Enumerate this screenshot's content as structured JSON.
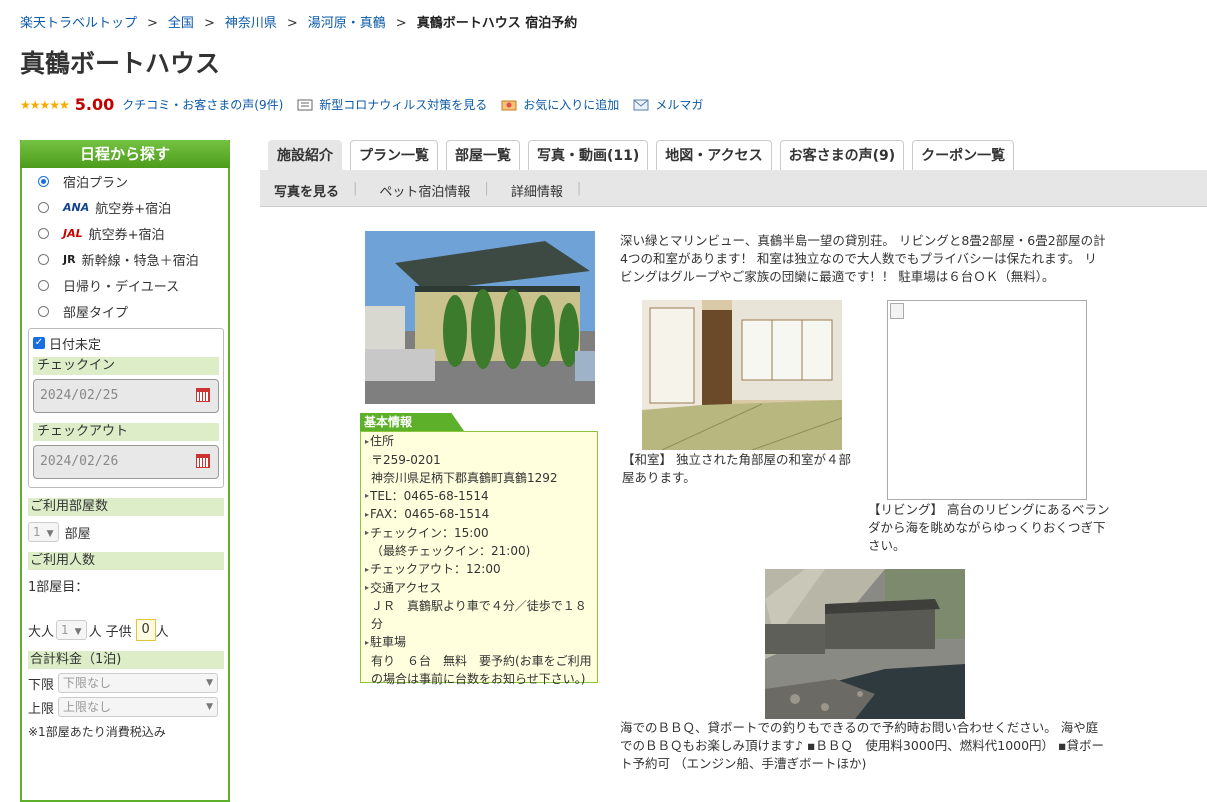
{
  "breadcrumb": {
    "items": [
      "楽天トラベルトップ",
      "全国",
      "神奈川県",
      "湯河原・真鶴"
    ],
    "separator": ">",
    "current": "真鶴ボートハウス 宿泊予約"
  },
  "hotel": {
    "name": "真鶴ボートハウス",
    "stars": "★★★★★",
    "score": "5.00",
    "reviews_link": "クチコミ・お客さまの声(9件)",
    "covid_link": "新型コロナウィルス対策を見る",
    "favorite_link": "お気に入りに追加",
    "mail_link": "メルマガ"
  },
  "sidebar": {
    "title": "日程から探す",
    "options": [
      {
        "prefix": "",
        "label": "宿泊プラン",
        "selected": true
      },
      {
        "prefix": "ANA",
        "label": "航空券+宿泊"
      },
      {
        "prefix": "JAL",
        "label": "航空券+宿泊"
      },
      {
        "prefix": "JR",
        "label": "新幹線・特急＋宿泊"
      },
      {
        "prefix": "",
        "label": "日帰り・デイユース"
      },
      {
        "prefix": "",
        "label": "部屋タイプ"
      }
    ],
    "undecided_label": "日付未定",
    "checkin_label": "チェックイン",
    "checkin_value": "2024/02/25",
    "checkout_label": "チェックアウト",
    "checkout_value": "2024/02/26",
    "rooms_label": "ご利用部屋数",
    "rooms_value": "1",
    "rooms_unit": "部屋",
    "people_label": "ご利用人数",
    "room1_label": "1部屋目：",
    "adult_label": "大人",
    "adult_value": "1",
    "adult_unit": "人",
    "child_label": "子供",
    "child_value": "0",
    "child_unit": "人",
    "total_label": "合計料金（1泊)",
    "min_label": "下限",
    "min_value": "下限なし",
    "max_label": "上限",
    "max_value": "上限なし",
    "note": "※1部屋あたり消費税込み"
  },
  "tabs": [
    "施設紹介",
    "プラン一覧",
    "部屋一覧",
    "写真・動画(11)",
    "地図・アクセス",
    "お客さまの声(9)",
    "クーポン一覧"
  ],
  "subnav": [
    "写真を見る",
    "ペット宿泊情報",
    "詳細情報"
  ],
  "basic_info": {
    "title": "基本情報",
    "address_label": "住所",
    "zip": "〒259-0201",
    "address": "神奈川県足柄下郡真鶴町真鶴1292",
    "tel": "TEL：0465-68-1514",
    "fax": "FAX：0465-68-1514",
    "checkin": "チェックイン：15:00",
    "last_checkin": "（最終チェックイン：21:00)",
    "checkout": "チェックアウト：12:00",
    "access_label": "交通アクセス",
    "access": "ＪＲ　真鶴駅より車で４分／徒歩で１８分",
    "parking_label": "駐車場",
    "parking": "有り　６台　無料　要予約(お車をご利用の場合は事前に台数をお知らせ下さい。)"
  },
  "intro": "深い緑とマリンビュー、真鶴半島一望の貸別荘。 リビングと8畳2部屋・6畳2部屋の計4つの和室があります！ 和室は独立なので大人数でもプライバシーは保たれます。 リビングはグループやご家族の団欒に最適です！！ 駐車場は６台ＯＫ（無料）。",
  "captions": {
    "washitsu": "【和室】 独立された角部屋の和室が４部屋あります。",
    "living": "【リビング】 高台のリビングにあるベランダから海を眺めながらゆっくりおくつぎ下さい。",
    "sea": "海でのＢＢＱ、貸ボートでの釣りもできるので予約時お問い合わせください。 海や庭でのＢＢＱもお楽しみ頂けます♪ ▪ＢＢＱ　使用料3000円、燃料代1000円） ▪貸ボート予約可 （エンジン船、手漕ぎボートほか)"
  }
}
